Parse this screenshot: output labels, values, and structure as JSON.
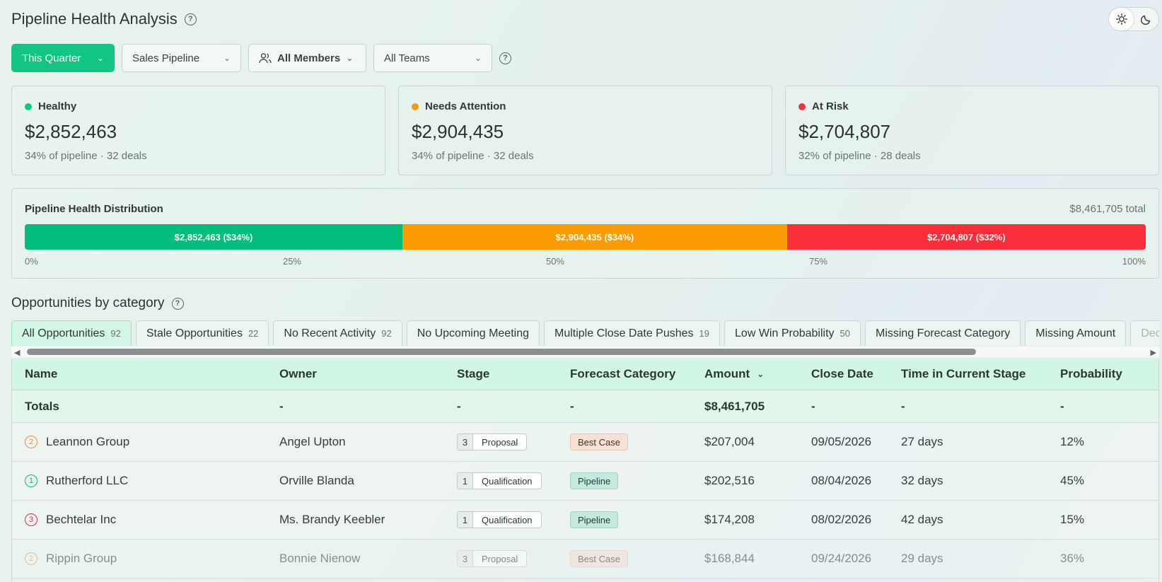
{
  "header": {
    "title": "Pipeline Health Analysis"
  },
  "filters": {
    "period": "This Quarter",
    "pipeline": "Sales Pipeline",
    "members": "All Members",
    "teams": "All Teams"
  },
  "kpis": [
    {
      "label": "Healthy",
      "value": "$2,852,463",
      "sub": "34% of pipeline · 32 deals",
      "color": "#13c583"
    },
    {
      "label": "Needs Attention",
      "value": "$2,904,435",
      "sub": "34% of pipeline · 32 deals",
      "color": "#f59c0b"
    },
    {
      "label": "At Risk",
      "value": "$2,704,807",
      "sub": "32% of pipeline · 28 deals",
      "color": "#f0313f"
    }
  ],
  "distribution": {
    "title": "Pipeline Health Distribution",
    "total": "$8,461,705 total",
    "segments": [
      {
        "label": "$2,852,463 ($34%)",
        "share": 33.7,
        "color": "#03bd7c"
      },
      {
        "label": "$2,904,435 ($34%)",
        "share": 34.3,
        "color": "#fb9c02"
      },
      {
        "label": "$2,704,807 ($32%)",
        "share": 32.0,
        "color": "#fb2d3b"
      }
    ],
    "ticks": [
      "0%",
      "25%",
      "50%",
      "75%",
      "100%"
    ]
  },
  "section": {
    "title": "Opportunities by category"
  },
  "tabs": [
    {
      "label": "All Opportunities",
      "count": "92"
    },
    {
      "label": "Stale Opportunities",
      "count": "22"
    },
    {
      "label": "No Recent Activity",
      "count": "92"
    },
    {
      "label": "No Upcoming Meeting",
      "count": ""
    },
    {
      "label": "Multiple Close Date Pushes",
      "count": "19"
    },
    {
      "label": "Low Win Probability",
      "count": "50"
    },
    {
      "label": "Missing Forecast Category",
      "count": ""
    },
    {
      "label": "Missing Amount",
      "count": ""
    },
    {
      "label": "Decl",
      "count": ""
    }
  ],
  "table": {
    "columns": [
      "Name",
      "Owner",
      "Stage",
      "Forecast Category",
      "Amount",
      "Close Date",
      "Time in Current Stage",
      "Probability"
    ],
    "totals": {
      "name": "Totals",
      "owner": "-",
      "stage": "-",
      "fc": "-",
      "amount": "$8,461,705",
      "close": "-",
      "time": "-",
      "prob": "-"
    },
    "rows": [
      {
        "prio": "2",
        "prio_color": "#e8913a",
        "name": "Leannon Group",
        "owner": "Angel Upton",
        "stage_num": "3",
        "stage": "Proposal",
        "fc": "Best Case",
        "fc_type": "best",
        "amount": "$207,004",
        "close": "09/05/2026",
        "time": "27 days",
        "prob": "12%"
      },
      {
        "prio": "1",
        "prio_color": "#13b37a",
        "name": "Rutherford LLC",
        "owner": "Orville Blanda",
        "stage_num": "1",
        "stage": "Qualification",
        "fc": "Pipeline",
        "fc_type": "pipe",
        "amount": "$202,516",
        "close": "08/04/2026",
        "time": "32 days",
        "prob": "45%"
      },
      {
        "prio": "3",
        "prio_color": "#e0353d",
        "name": "Bechtelar Inc",
        "owner": "Ms. Brandy Keebler",
        "stage_num": "1",
        "stage": "Qualification",
        "fc": "Pipeline",
        "fc_type": "pipe",
        "amount": "$174,208",
        "close": "08/02/2026",
        "time": "42 days",
        "prob": "15%"
      },
      {
        "prio": "2",
        "prio_color": "#e8913a",
        "name": "Rippin Group",
        "owner": "Bonnie Nienow",
        "stage_num": "3",
        "stage": "Proposal",
        "fc": "Best Case",
        "fc_type": "best",
        "amount": "$168,844",
        "close": "09/24/2026",
        "time": "29 days",
        "prob": "36%"
      }
    ]
  }
}
